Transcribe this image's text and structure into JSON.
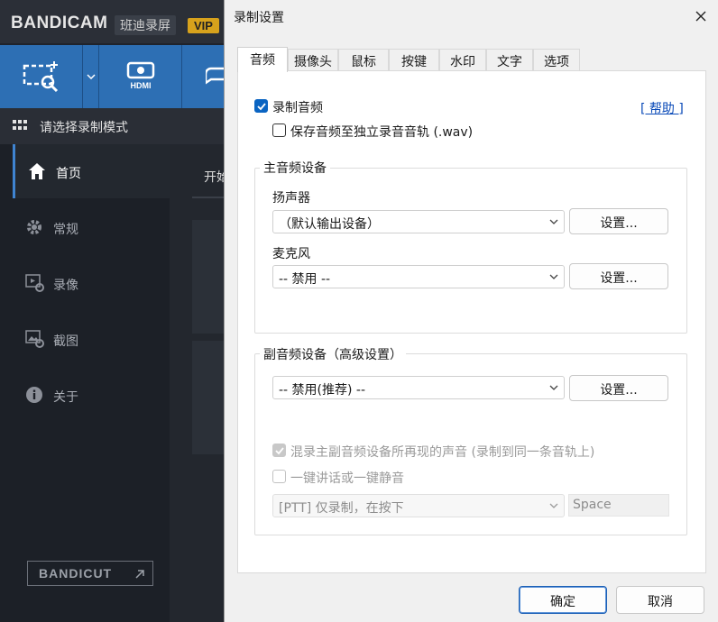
{
  "background_app": {
    "brand": "BANDICAM",
    "brand_sub": "班迪录屏",
    "vip_badge": "VIP",
    "section_title": "请选择录制模式",
    "nav_items": [
      {
        "label": "首页",
        "icon": "home-icon"
      },
      {
        "label": "常规",
        "icon": "gear-icon"
      },
      {
        "label": "录像",
        "icon": "video-settings-icon"
      },
      {
        "label": "截图",
        "icon": "image-settings-icon"
      },
      {
        "label": "关于",
        "icon": "info-icon"
      }
    ],
    "content_label": "开始",
    "bandicut_label": "BANDICUT",
    "accent_color": "#2d6fb4"
  },
  "dialog": {
    "title": "录制设置",
    "close_icon": "close-icon",
    "tabs": [
      {
        "label": "音频",
        "active": true
      },
      {
        "label": "摄像头",
        "active": false
      },
      {
        "label": "鼠标",
        "active": false
      },
      {
        "label": "按键",
        "active": false
      },
      {
        "label": "水印",
        "active": false
      },
      {
        "label": "文字",
        "active": false
      },
      {
        "label": "选项",
        "active": false
      }
    ],
    "record_audio": {
      "label": "录制音频",
      "checked": true
    },
    "save_wav": {
      "label": "保存音频至独立录音音轨 (.wav)",
      "checked": false
    },
    "help_link": "[ 帮助 ]",
    "primary_group": {
      "title": "主音频设备",
      "speaker_label": "扬声器",
      "speaker_value": "（默认输出设备）",
      "speaker_settings": "设置...",
      "mic_label": "麦克风",
      "mic_value": "-- 禁用 --",
      "mic_settings": "设置..."
    },
    "secondary_group": {
      "title": "副音频设备（高级设置）",
      "device_value": "-- 禁用(推荐) --",
      "device_settings": "设置...",
      "mix_label": "混录主副音频设备所再现的声音 (录制到同一条音轨上)",
      "mix_checked": true,
      "ptt_label": "一键讲话或一键静音",
      "ptt_checked": false,
      "ptt_mode_value": "[PTT] 仅录制，在按下",
      "ptt_key_value": "Space"
    },
    "ok_label": "确定",
    "cancel_label": "取消"
  }
}
